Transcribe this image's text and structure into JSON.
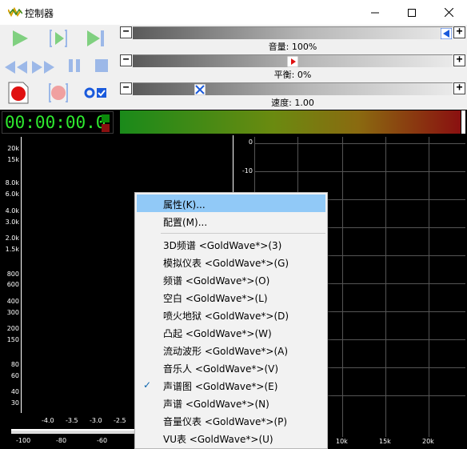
{
  "window": {
    "title": "控制器",
    "controls": [
      "minimize",
      "maximize",
      "close"
    ]
  },
  "transport": {
    "buttons": [
      "play",
      "play-selection",
      "play-to-end",
      "rewind",
      "fast-forward",
      "pause",
      "stop",
      "record",
      "record-selection",
      "record-options"
    ],
    "colors": {
      "play": "#80d080",
      "record": "#e01010",
      "disabled_blue": "#9cb8e8"
    }
  },
  "sliders": {
    "volume": {
      "label": "音量: 100%",
      "minus": "−",
      "plus": "+",
      "value_fraction": 1.0
    },
    "balance": {
      "label": "平衡: 0%",
      "minus": "−",
      "plus": "+",
      "value_fraction": 0.5
    },
    "speed": {
      "label": "速度: 1.00",
      "minus": "−",
      "plus": "+",
      "value_fraction": 0.21
    }
  },
  "timer": {
    "display": "00:00:00.0"
  },
  "spectrum_left": {
    "y_labels": [
      "20k",
      "15k",
      "8.0k",
      "6.0k",
      "4.0k",
      "3.0k",
      "2.0k",
      "1.5k",
      "800",
      "600",
      "400",
      "300",
      "200",
      "150",
      "80",
      "60",
      "40",
      "30"
    ],
    "x_labels": [
      "-4.0",
      "-3.5",
      "-3.0",
      "-2.5"
    ],
    "ruler_labels": [
      "-100",
      "-80",
      "-60"
    ]
  },
  "spectrum_right": {
    "y_labels": [
      "0",
      "-10"
    ],
    "x_labels": [
      "10k",
      "15k",
      "20k"
    ]
  },
  "context_menu": {
    "items": [
      {
        "label": "属性(K)...",
        "highlighted": true,
        "checked": false
      },
      {
        "label": "配置(M)...",
        "highlighted": false,
        "checked": false
      },
      {
        "separator": true
      },
      {
        "label": "3D频谱 <GoldWave*>(3)",
        "highlighted": false,
        "checked": false
      },
      {
        "label": "模拟仪表 <GoldWave*>(G)",
        "highlighted": false,
        "checked": false
      },
      {
        "label": "频谱 <GoldWave*>(O)",
        "highlighted": false,
        "checked": false
      },
      {
        "label": "空白 <GoldWave*>(L)",
        "highlighted": false,
        "checked": false
      },
      {
        "label": "喷火地狱 <GoldWave*>(D)",
        "highlighted": false,
        "checked": false
      },
      {
        "label": "凸起 <GoldWave*>(W)",
        "highlighted": false,
        "checked": false
      },
      {
        "label": "流动波形 <GoldWave*>(A)",
        "highlighted": false,
        "checked": false
      },
      {
        "label": "音乐人 <GoldWave*>(V)",
        "highlighted": false,
        "checked": false
      },
      {
        "label": "声谱图 <GoldWave*>(E)",
        "highlighted": false,
        "checked": true
      },
      {
        "label": "声谱 <GoldWave*>(N)",
        "highlighted": false,
        "checked": false
      },
      {
        "label": "音量仪表 <GoldWave*>(P)",
        "highlighted": false,
        "checked": false
      },
      {
        "label": "VU表 <GoldWave*>(U)",
        "highlighted": false,
        "checked": false
      }
    ],
    "check_mark": "✓"
  }
}
